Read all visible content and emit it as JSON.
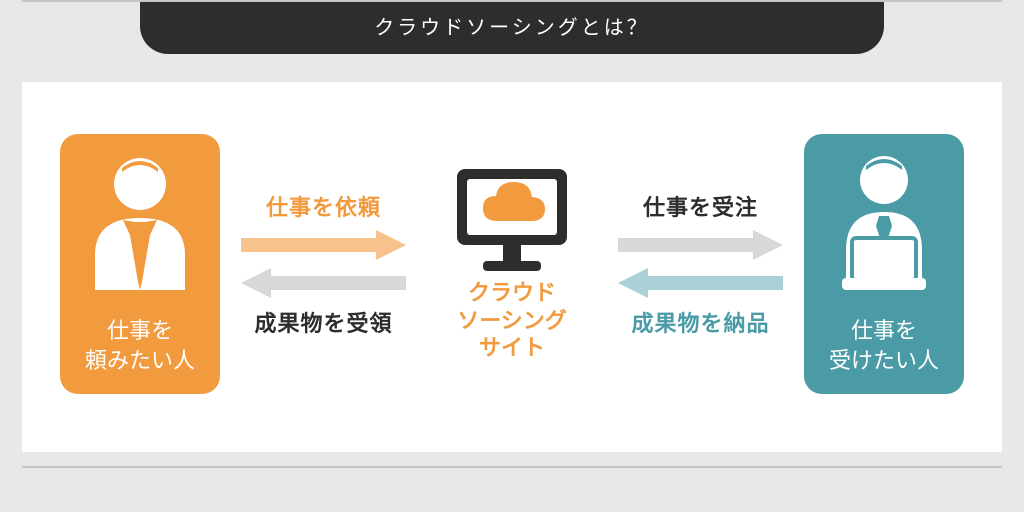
{
  "title": "クラウドソーシングとは？",
  "colors": {
    "orange": "#f19a3e",
    "orangeLight": "#f7c28c",
    "teal": "#4a9ba6",
    "tealLight": "#a9d1d6",
    "dark": "#2d2d2d",
    "grayArrow": "#d8d8d8"
  },
  "left_actor": {
    "label_line1": "仕事を",
    "label_line2": "頼みたい人"
  },
  "right_actor": {
    "label_line1": "仕事を",
    "label_line2": "受けたい人"
  },
  "center": {
    "label_line1": "クラウド",
    "label_line2": "ソーシング",
    "label_line3": "サイト"
  },
  "flows": {
    "left_top": "仕事を依頼",
    "left_bottom": "成果物を受領",
    "right_top": "仕事を受注",
    "right_bottom": "成果物を納品"
  }
}
